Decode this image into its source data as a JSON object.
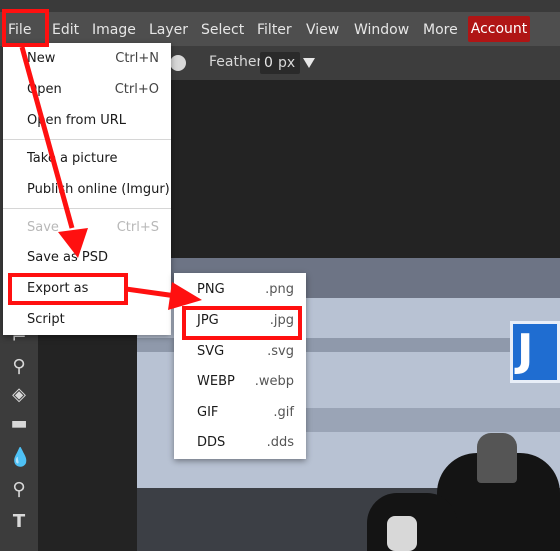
{
  "menubar": {
    "items": [
      "File",
      "Edit",
      "Image",
      "Layer",
      "Select",
      "Filter",
      "View",
      "Window",
      "More"
    ],
    "account_label": "Account"
  },
  "options": {
    "feather_label": "Feather:",
    "feather_value": "0",
    "feather_unit": "px"
  },
  "file_menu": {
    "items": [
      {
        "label": "New",
        "shortcut": "Ctrl+N"
      },
      {
        "label": "Open",
        "shortcut": "Ctrl+O"
      },
      {
        "label": "Open from URL",
        "shortcut": ""
      },
      {
        "label": "Take a picture",
        "shortcut": ""
      },
      {
        "label": "Publish online (Imgur)",
        "shortcut": ""
      },
      {
        "label": "Save",
        "shortcut": "Ctrl+S",
        "disabled": true
      },
      {
        "label": "Save as PSD",
        "shortcut": ""
      },
      {
        "label": "Export as",
        "shortcut": ""
      },
      {
        "label": "Script",
        "shortcut": ""
      }
    ]
  },
  "export_menu": {
    "items": [
      {
        "label": "PNG",
        "ext": ".png"
      },
      {
        "label": "JPG",
        "ext": ".jpg"
      },
      {
        "label": "SVG",
        "ext": ".svg"
      },
      {
        "label": "WEBP",
        "ext": ".webp"
      },
      {
        "label": "GIF",
        "ext": ".gif"
      },
      {
        "label": "DDS",
        "ext": ".dds"
      }
    ]
  },
  "photo": {
    "sign_letter": "J"
  },
  "toolbar": {
    "tools": [
      "stamp-icon",
      "eraser-icon",
      "gradient-icon",
      "blur-icon",
      "dodge-icon",
      "text-icon"
    ]
  },
  "colors": {
    "accent_red": "#ff1010",
    "account_bg": "#b01515"
  }
}
